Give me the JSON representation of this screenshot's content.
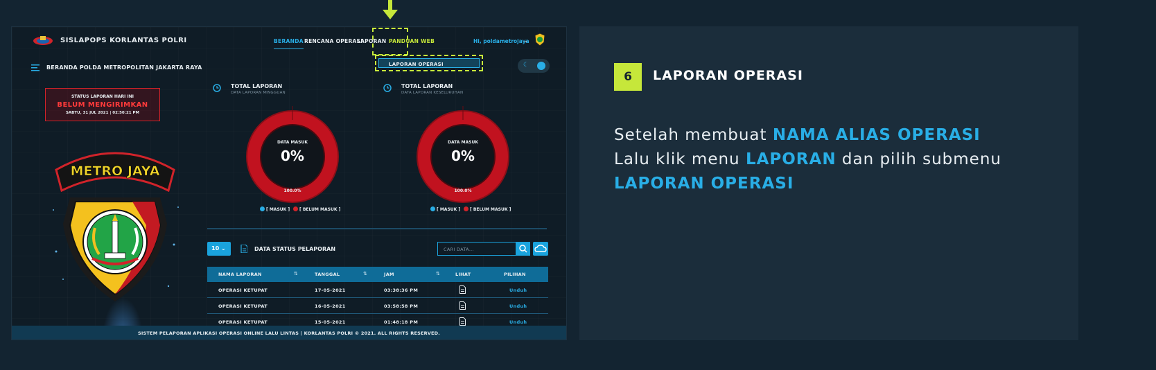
{
  "app": {
    "brand": "SISLAPOPS KORLANTAS POLRI",
    "nav": {
      "beranda": "BERANDA",
      "rencana": "RENCANA OPERASI",
      "laporan": "LAPORAN",
      "panduan": "PANDUAN WEB"
    },
    "user": "Hi, poldametrojaya",
    "dropdown_item": "LAPORAN OPERASI",
    "breadcrumb": "BERANDA POLDA METROPOLITAN JAKARTA RAYA",
    "status": {
      "label": "STATUS LAPORAN HARI INI",
      "value": "BELUM MENGIRIMKAN",
      "date": "SABTU, 31 JUL 2021 | 02:50:21 PM"
    },
    "badge_text": "METRO JAYA",
    "stats": [
      {
        "title": "TOTAL LAPORAN",
        "subtitle": "DATA LAPORAN MINGGUAN",
        "center_label": "DATA MASUK",
        "value": "0%",
        "bottom": "100.0%",
        "masuk_pct": 0
      },
      {
        "title": "TOTAL LAPORAN",
        "subtitle": "DATA LAPORAN KESELURUHAN",
        "center_label": "DATA MASUK",
        "value": "0%",
        "bottom": "100.0%",
        "masuk_pct": 0
      }
    ],
    "legend": {
      "masuk": "[ MASUK ]",
      "belum": "[ BELUM MASUK ]"
    },
    "colors": {
      "accent": "#29aee6",
      "danger": "#d1232a",
      "highlight": "#c6e73a"
    },
    "table": {
      "page_size": "10",
      "title": "DATA STATUS PELAPORAN",
      "search_placeholder": "CARI DATA...",
      "headers": [
        "NAMA LAPORAN",
        "TANGGAL",
        "JAM",
        "LIHAT",
        "PILIHAN"
      ],
      "rows": [
        {
          "nama": "OPERASI KETUPAT",
          "tanggal": "17-05-2021",
          "jam": "03:38:36 PM",
          "pilihan": "Unduh"
        },
        {
          "nama": "OPERASI KETUPAT",
          "tanggal": "16-05-2021",
          "jam": "03:58:58 PM",
          "pilihan": "Unduh"
        },
        {
          "nama": "OPERASI KETUPAT",
          "tanggal": "15-05-2021",
          "jam": "01:48:18 PM",
          "pilihan": "Unduh"
        }
      ]
    },
    "footer": "SISTEM PELAPORAN APLIKASI OPERASI ONLINE LALU LINTAS | KORLANTAS POLRI © 2021. ALL RIGHTS RESERVED."
  },
  "info": {
    "step": "6",
    "title": "LAPORAN OPERASI",
    "desc": {
      "p1": "Setelah membuat ",
      "h1": "NAMA ALIAS OPERASI",
      "p2": "Lalu klik menu ",
      "h2": "LAPORAN",
      "p3": " dan pilih submenu",
      "h3": "LAPORAN OPERASI"
    }
  }
}
